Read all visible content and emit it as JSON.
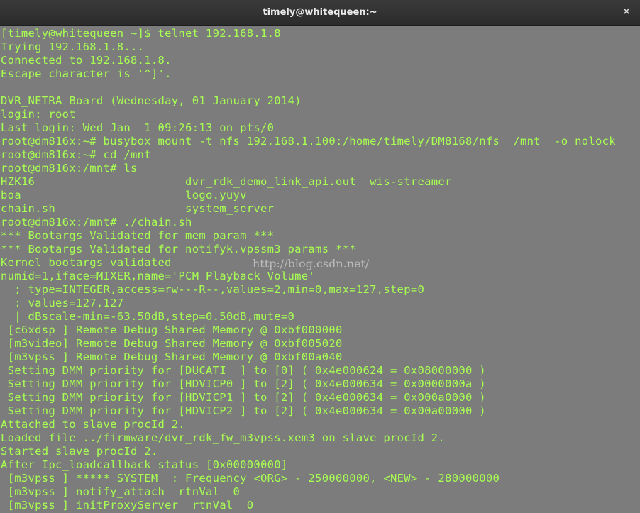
{
  "window": {
    "title": "timely@whitequeen:~",
    "close_icon": "✕"
  },
  "terminal": {
    "text_color": "#a8ff52",
    "background_color": "#7c7c7c",
    "lines": [
      "[timely@whitequeen ~]$ telnet 192.168.1.8",
      "Trying 192.168.1.8...",
      "Connected to 192.168.1.8.",
      "Escape character is '^]'.",
      "",
      "DVR_NETRA Board (Wednesday, 01 January 2014)",
      "login: root",
      "Last login: Wed Jan  1 09:26:13 on pts/0",
      "root@dm816x:~# busybox mount -t nfs 192.168.1.100:/home/timely/DM8168/nfs  /mnt  -o nolock",
      "root@dm816x:~# cd /mnt",
      "root@dm816x:/mnt# ls",
      "HZK16                      dvr_rdk_demo_link_api.out  wis-streamer",
      "boa                        logo.yuyv",
      "chain.sh                   system_server",
      "root@dm816x:/mnt# ./chain.sh",
      "*** Bootargs Validated for mem param ***",
      "*** Bootargs Validated for notifyk.vpssm3 params ***",
      "Kernel bootargs validated",
      "numid=1,iface=MIXER,name='PCM Playback Volume'",
      "  ; type=INTEGER,access=rw---R--,values=2,min=0,max=127,step=0",
      "  : values=127,127",
      "  | dBscale-min=-63.50dB,step=0.50dB,mute=0",
      " [c6xdsp ] Remote Debug Shared Memory @ 0xbf000000",
      " [m3video] Remote Debug Shared Memory @ 0xbf005020",
      " [m3vpss ] Remote Debug Shared Memory @ 0xbf00a040",
      " Setting DMM priority for [DUCATI  ] to [0] ( 0x4e000624 = 0x08000000 )",
      " Setting DMM priority for [HDVICP0 ] to [2] ( 0x4e000634 = 0x0000000a )",
      " Setting DMM priority for [HDVICP1 ] to [2] ( 0x4e000634 = 0x000a0000 )",
      " Setting DMM priority for [HDVICP2 ] to [2] ( 0x4e000634 = 0x00a00000 )",
      "Attached to slave procId 2.",
      "Loaded file ../firmware/dvr_rdk_fw_m3vpss.xem3 on slave procId 2.",
      "Started slave procId 2.",
      "After Ipc_loadcallback status [0x00000000]",
      " [m3vpss ] ***** SYSTEM  : Frequency <ORG> - 250000000, <NEW> - 280000000",
      " [m3vpss ] notify_attach  rtnVal  0",
      " [m3vpss ] initProxyServer  rtnVal  0"
    ],
    "watermark": "http://blog.csdn.net/"
  }
}
